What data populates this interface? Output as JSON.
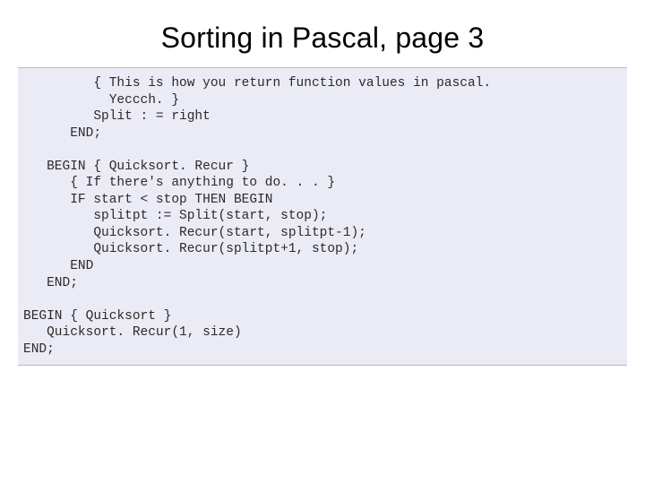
{
  "title": "Sorting in Pascal, page 3",
  "code": "         { This is how you return function values in pascal.\n           Yeccch. }\n         Split : = right\n      END;\n\n   BEGIN { Quicksort. Recur }\n      { If there's anything to do. . . }\n      IF start < stop THEN BEGIN\n         splitpt := Split(start, stop);\n         Quicksort. Recur(start, splitpt-1);\n         Quicksort. Recur(splitpt+1, stop);\n      END\n   END;\n\nBEGIN { Quicksort }\n   Quicksort. Recur(1, size)\nEND;"
}
